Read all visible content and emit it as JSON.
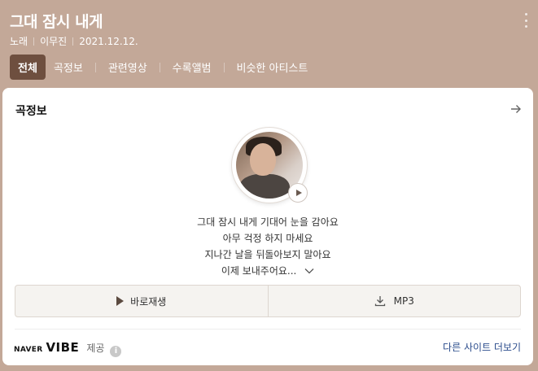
{
  "header": {
    "title": "그대 잠시 내게",
    "meta": [
      "노래",
      "이무진",
      "2021.12.12."
    ],
    "tabs": [
      "전체",
      "곡정보",
      "관련영상",
      "수록앨범",
      "비슷한 아티스트"
    ]
  },
  "card": {
    "title": "곡정보",
    "lyrics": [
      "그대 잠시 내게 기대어 눈을 감아요",
      "아무 걱정 하지 마세요",
      "지나간 날을 뒤돌아보지 말아요",
      "이제 보내주어요..."
    ],
    "play_label": "바로재생",
    "mp3_label": "MP3",
    "brand": {
      "naver": "NAVER",
      "vibe": "VIBE"
    },
    "provided_label": "제공",
    "info_glyph": "i",
    "more_sites_label": "다른 사이트 더보기"
  },
  "colors": {
    "header_bg": "#c3a898",
    "active_tab": "#6e4f3f",
    "link": "#2b4c8c"
  },
  "icons": {
    "more": "more-vertical-icon",
    "arrow": "arrow-right-icon",
    "play": "play-icon",
    "download": "download-icon",
    "chevron": "chevron-down-icon",
    "info": "info-icon"
  }
}
